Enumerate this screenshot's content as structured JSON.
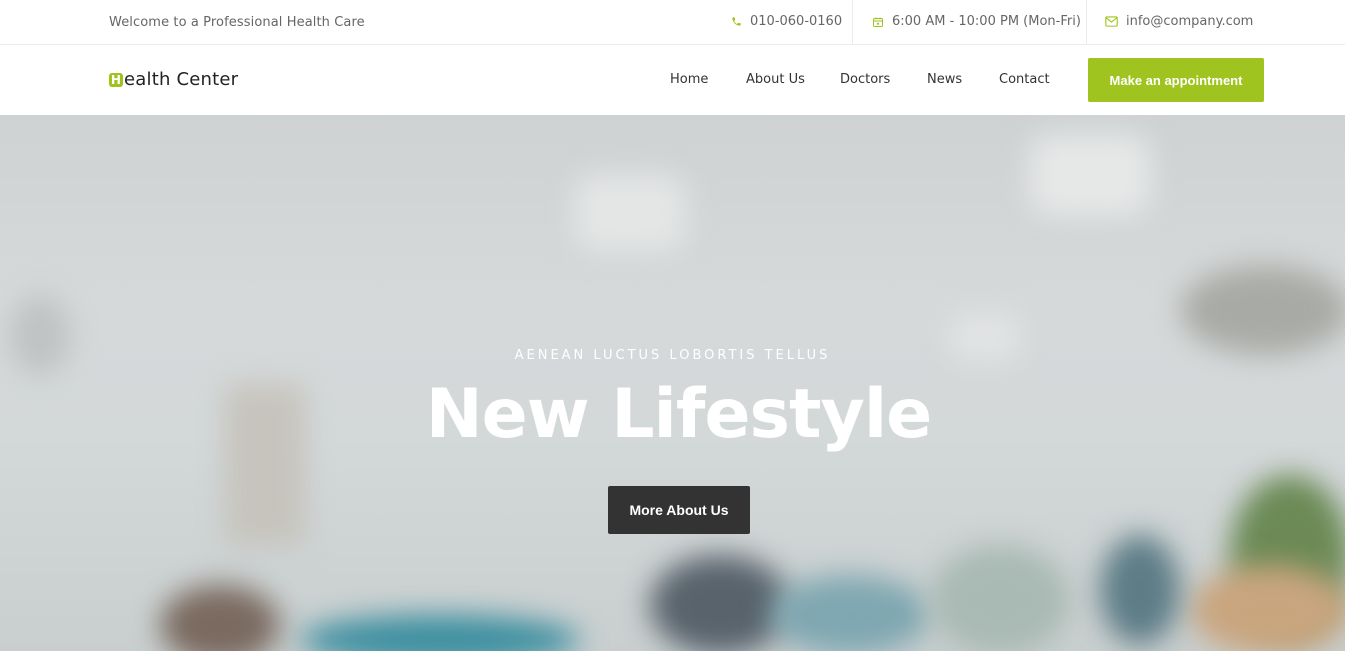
{
  "topbar": {
    "welcome": "Welcome to a Professional Health Care",
    "phone": "010-060-0160",
    "hours": "6:00 AM - 10:00 PM (Mon-Fri)",
    "email": "info@company.com"
  },
  "navbar": {
    "logo_initial": "H",
    "logo_rest": "ealth Center",
    "links": [
      "Home",
      "About Us",
      "Doctors",
      "News",
      "Contact"
    ],
    "cta": "Make an appointment"
  },
  "hero": {
    "kicker": "AENEAN LUCTUS LOBORTIS TELLUS",
    "headline": "New Lifestyle",
    "button": "More About Us"
  },
  "colors": {
    "accent": "#a0c41f",
    "button_dark": "#333333"
  }
}
